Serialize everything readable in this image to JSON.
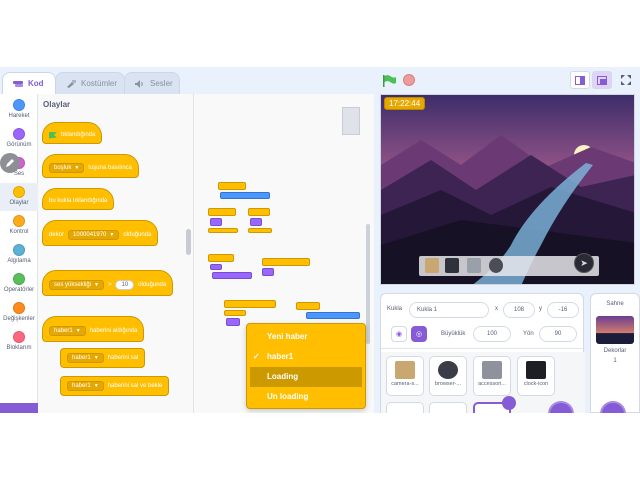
{
  "tabs": [
    {
      "label": "Kod",
      "icon": "code-icon",
      "active": true
    },
    {
      "label": "Kostümler",
      "icon": "brush-icon",
      "active": false
    },
    {
      "label": "Sesler",
      "icon": "speaker-icon",
      "active": false
    }
  ],
  "categories": [
    {
      "label": "Hareket",
      "color": "#4c97ff"
    },
    {
      "label": "Görünüm",
      "color": "#9966ff"
    },
    {
      "label": "Ses",
      "color": "#cf63cf"
    },
    {
      "label": "Olaylar",
      "color": "#ffbf00",
      "selected": true
    },
    {
      "label": "Kontrol",
      "color": "#ffab19"
    },
    {
      "label": "Algılama",
      "color": "#5cb1d6"
    },
    {
      "label": "Operatörler",
      "color": "#59c059"
    },
    {
      "label": "Değişkenler",
      "color": "#ff8c1a"
    },
    {
      "label": "Bloklarım",
      "color": "#ff6680"
    }
  ],
  "palette": {
    "title": "Olaylar",
    "blocks": {
      "flag_clicked": "tıklandığında",
      "key_select": "boşluk",
      "key_pressed": "tuşuna basılınca",
      "sprite_clicked": "bu kukla tıklandığında",
      "backdrop_label": "dekor",
      "backdrop_value": "1000041970",
      "backdrop_switch": "olduğunda",
      "loudness_select": "ses yüksekliği",
      "loudness_op": ">",
      "loudness_value": "10",
      "loudness_when": "olduğunda",
      "msg_receive": "haber1",
      "msg_receive_label": "haberini aldığında",
      "msg_broadcast": "haber1",
      "msg_broadcast_label": "haberini sal",
      "msg_broadcast_wait": "haber1",
      "msg_broadcast_wait_label": "haberini sal ve bekle"
    }
  },
  "dropdown": {
    "items": [
      {
        "label": "Yeni haber",
        "checked": false,
        "highlighted": false
      },
      {
        "label": "haber1",
        "checked": true,
        "highlighted": false
      },
      {
        "label": "Loading",
        "checked": false,
        "highlighted": true
      },
      {
        "label": "Un loading",
        "checked": false,
        "highlighted": false
      }
    ],
    "check_mark": "✓"
  },
  "stage": {
    "timer": "17:22:44"
  },
  "sprite_info": {
    "sprite_label": "Kukla",
    "sprite_name": "Kukla 1",
    "x_label": "x",
    "x_value": "108",
    "y_label": "y",
    "y_value": "-16",
    "size_label": "Büyüklük",
    "size_value": "100",
    "direction_label": "Yön",
    "direction_value": "90"
  },
  "sprites": [
    {
      "name": "camera-s...",
      "color": "#c8a870"
    },
    {
      "name": "browser-...",
      "color": "#3a3d48"
    },
    {
      "name": "accessori...",
      "color": "#8d929c"
    },
    {
      "name": "clock-icon",
      "color": "#1d1f25"
    }
  ],
  "stage_pane": {
    "title": "Sahne",
    "backdrops_label": "Dekorlar",
    "backdrops_count": "1"
  }
}
